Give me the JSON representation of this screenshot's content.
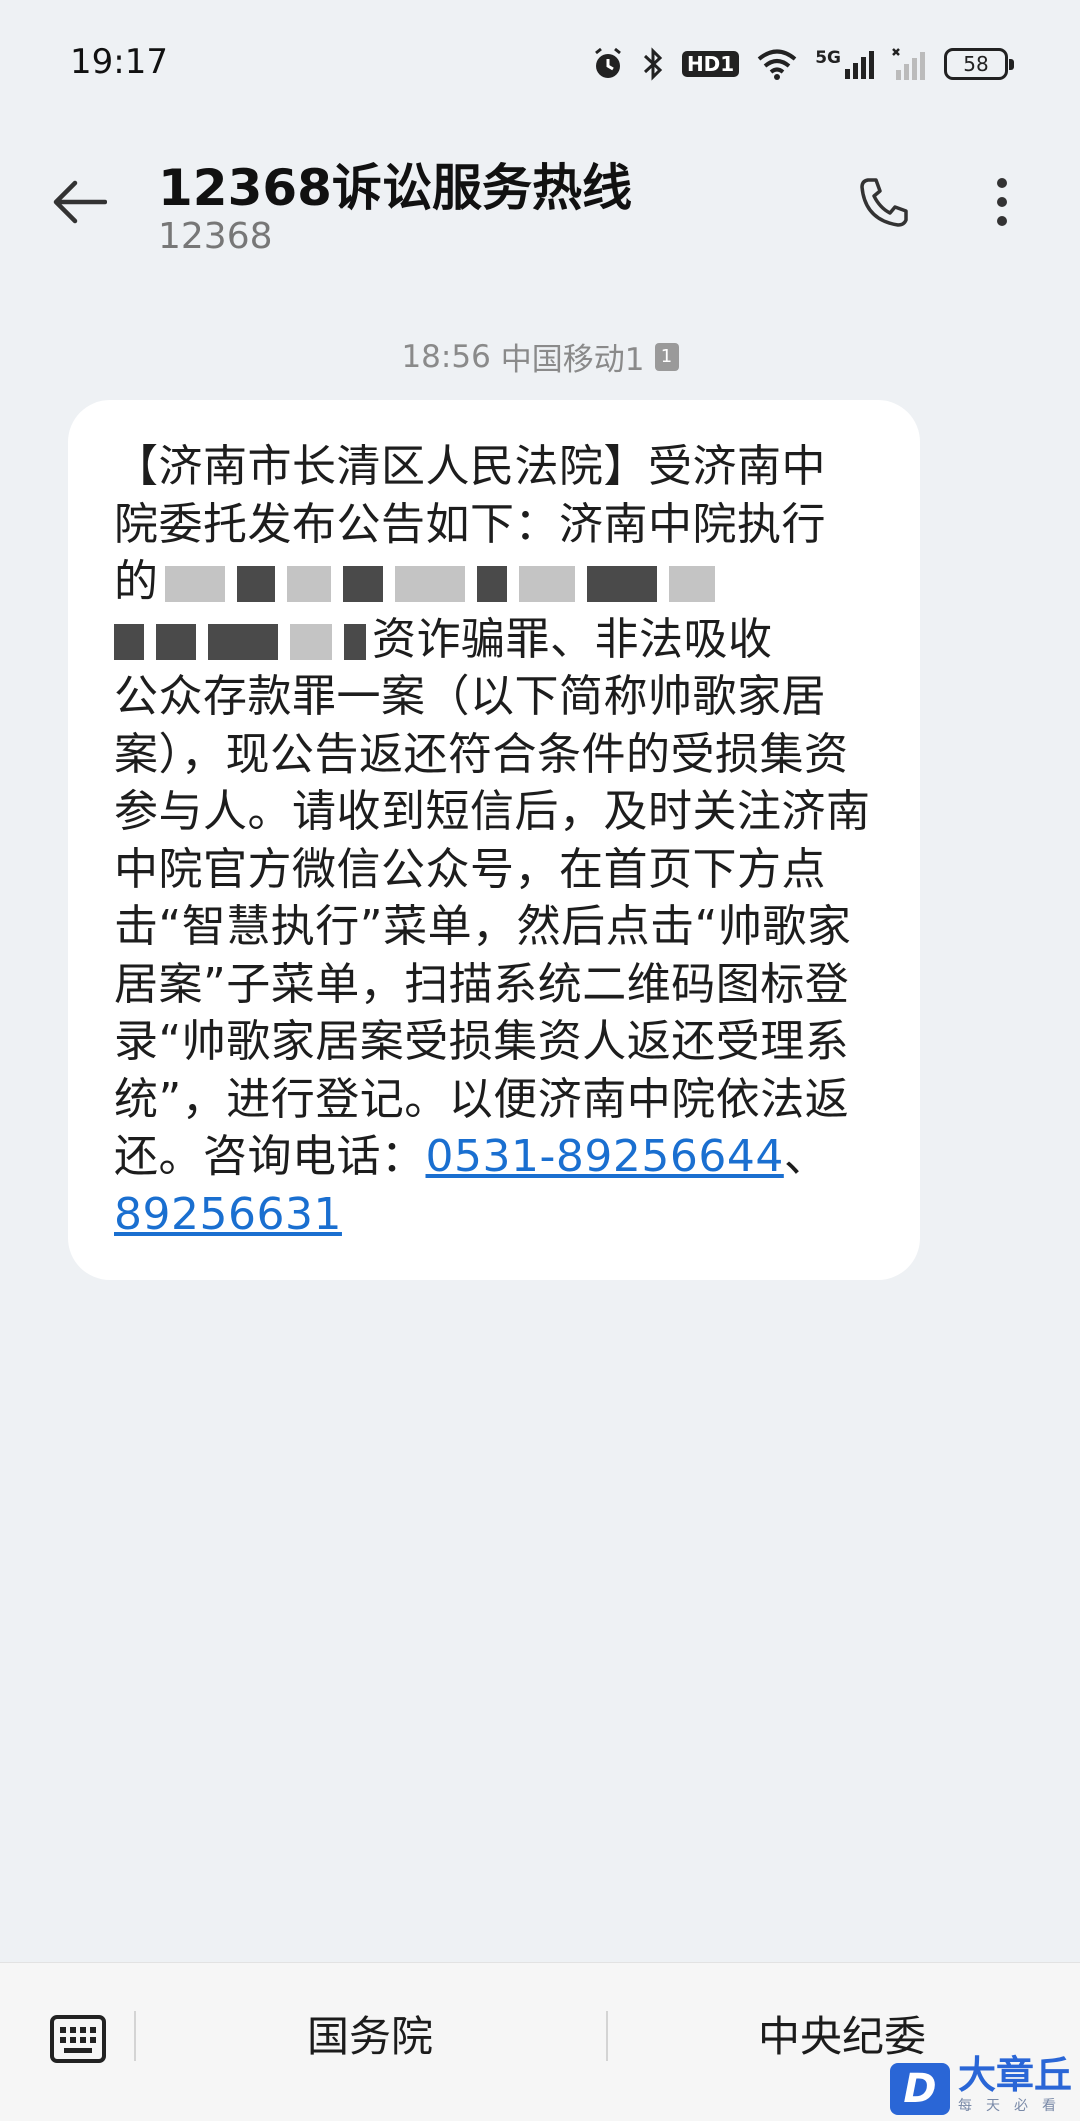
{
  "status_bar": {
    "time": "19:17",
    "hd_label": "HD1",
    "network_label": "5G",
    "battery_level": "58"
  },
  "header": {
    "title": "12368诉讼服务热线",
    "subtitle": "12368"
  },
  "conversation": {
    "timestamp": "18:56",
    "carrier": "中国移动1",
    "sim_badge": "1",
    "message": {
      "line_1": "【济南市长清区人民法院】受济南中",
      "line_2": "院委托发布公告如下：济南中院执行",
      "line_3_visible": "的",
      "line_4_visible": "资诈骗罪、非法吸收",
      "body_rest": "公众存款罪一案（以下简称帅歌家居案），现公告返还符合条件的受损集资参与人。请收到短信后，及时关注济南中院官方微信公众号，在首页下方点击“智慧执行”菜单，然后点击“帅歌家居案”子菜单，扫描系统二维码图标登录“帅歌家居案受损集资人返还受理系统”，进行登记。以便济南中院依法返还。咨询电话：",
      "phone_1": "0531-89256644",
      "separator": "、",
      "phone_2": "89256631"
    }
  },
  "bottom_bar": {
    "quick_reply_1": "国务院",
    "quick_reply_2": "中央纪委"
  },
  "watermark": {
    "logo_letter": "D",
    "name": "大章丘",
    "slogan": "每天必看"
  },
  "colors": {
    "background": "#eef1f4",
    "bubble": "#ffffff",
    "link": "#1a6fd0",
    "watermark_blue": "#2a66d6"
  }
}
